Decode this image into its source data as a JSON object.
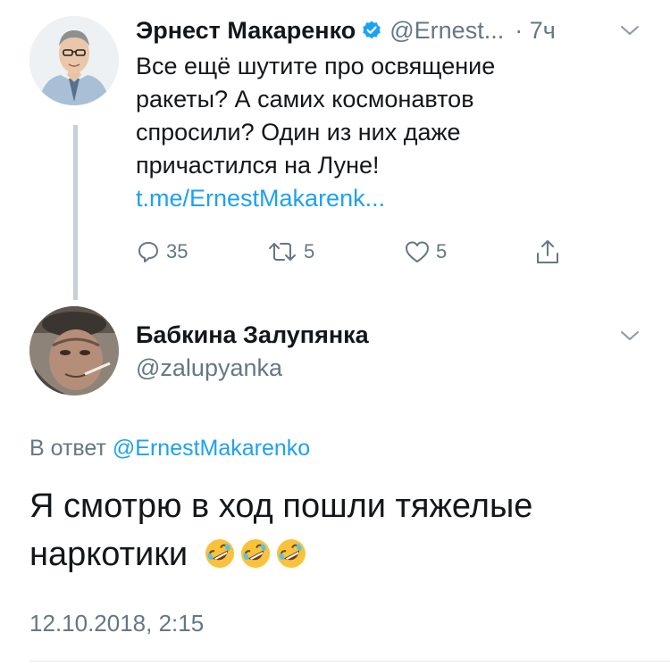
{
  "tweet": {
    "author_name": "Эрнест Макаренко",
    "handle": "@Ernest...",
    "time": "· 7ч",
    "text_lines": [
      "Все ещё шутите про освящение",
      "ракеты? А самих космонавтов",
      "спросили? Один из них даже",
      "причастился на Луне!"
    ],
    "link": "t.me/ErnestMakarenk...",
    "actions": {
      "replies": "35",
      "retweets": "5",
      "likes": "5"
    }
  },
  "reply": {
    "author_name": "Бабкина Залупянка",
    "handle": "@zalupyanka",
    "in_reply_prefix": "В ответ",
    "in_reply_mention": "@ErnestMakarenko",
    "text_line1": "Я смотрю в ход пошли тяжелые",
    "text_line2": "наркотики",
    "timestamp": "12.10.2018, 2:15"
  },
  "colors": {
    "text": "#14171a",
    "secondary": "#657786",
    "accent": "#1da1f2",
    "thread_line": "#c4cfd6"
  },
  "icons": [
    "verified-icon",
    "chevron-down-icon",
    "reply-icon",
    "retweet-icon",
    "like-icon",
    "share-icon",
    "rofl-emoji"
  ]
}
